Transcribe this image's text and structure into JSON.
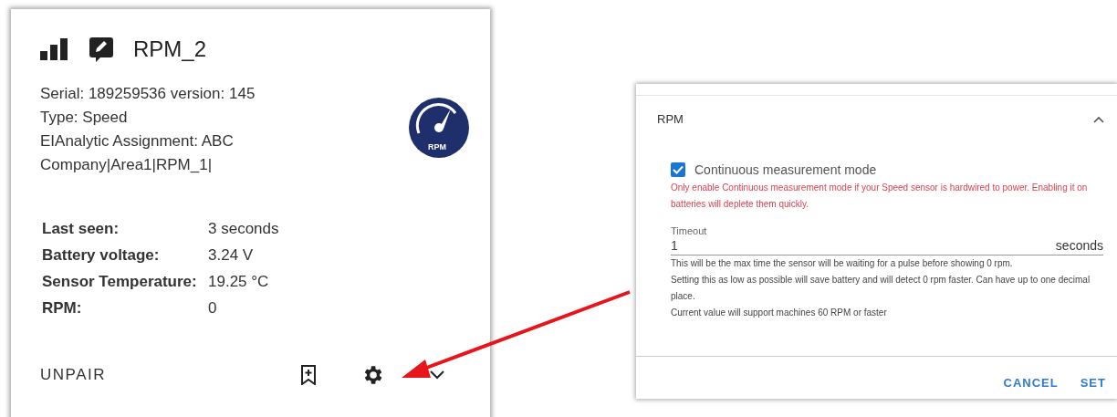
{
  "sensor_card": {
    "title": "RPM_2",
    "details": [
      "Serial: 189259536 version: 145",
      "Type: Speed",
      "EIAnalytic Assignment: ABC Company|Area1|RPM_1|"
    ],
    "stats": [
      {
        "label": "Last seen:",
        "value": "3 seconds"
      },
      {
        "label": "Battery voltage:",
        "value": "3.24 V"
      },
      {
        "label": "Sensor Temperature:",
        "value": "19.25 °C"
      },
      {
        "label": "RPM:",
        "value": "0"
      }
    ],
    "gauge_label": "RPM",
    "actions": {
      "unpair": "UNPAIR"
    }
  },
  "settings_dialog": {
    "section": {
      "title": "RPM",
      "expanded": true
    },
    "checkbox": {
      "label": "Continuous measurement mode",
      "checked": true
    },
    "warning": "Only enable Continuous measurement mode if your Speed sensor is hardwired to power. Enabling it on batteries will deplete them quickly.",
    "timeout": {
      "label": "Timeout",
      "value": "1",
      "unit": "seconds"
    },
    "help": [
      "This will be the max time the sensor will be waiting for a pulse before showing 0 rpm.",
      "Setting this as low as possible will save battery and will detect 0 rpm faster. Can have up to one decimal place.",
      "Current value will support machines 60 RPM or faster"
    ],
    "buttons": [
      "CANCEL",
      "SET"
    ]
  }
}
